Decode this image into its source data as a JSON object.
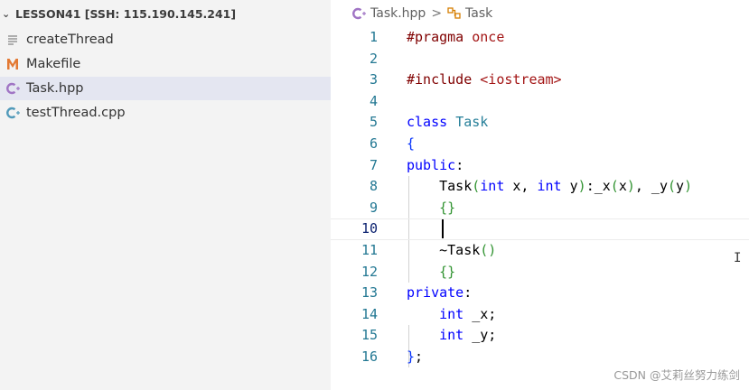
{
  "explorer": {
    "folder_title": "LESSON41 [SSH: 115.190.145.241]",
    "files": [
      {
        "name": "createThread",
        "icon": "text-file-icon"
      },
      {
        "name": "Makefile",
        "icon": "makefile-icon"
      },
      {
        "name": "Task.hpp",
        "icon": "cpp-header-icon",
        "selected": true
      },
      {
        "name": "testThread.cpp",
        "icon": "cpp-file-icon"
      }
    ]
  },
  "breadcrumb": {
    "file": "Task.hpp",
    "separator": ">",
    "symbol": "Task"
  },
  "editor": {
    "line_numbers": [
      "1",
      "2",
      "3",
      "4",
      "5",
      "6",
      "7",
      "8",
      "9",
      "10",
      "11",
      "12",
      "13",
      "14",
      "15",
      "16"
    ],
    "lines": [
      "#pragma once",
      "",
      "#include <iostream>",
      "",
      "class Task",
      "{",
      "public:",
      "    Task(int x, int y):_x(x), _y(y)",
      "    {}",
      "    ",
      "    ~Task()",
      "    {}",
      "private:",
      "    int _x;",
      "    int _y;",
      "};"
    ],
    "current_line": 10,
    "ibeam_cursor": "I"
  },
  "watermark": "CSDN @艾莉丝努力练剑",
  "colors": {
    "keyword": "#0000ff",
    "preprocessor": "#800000",
    "string": "#a31515",
    "type": "#267f99",
    "line_number": "#237893",
    "selection_bg": "#e4e6f1"
  }
}
